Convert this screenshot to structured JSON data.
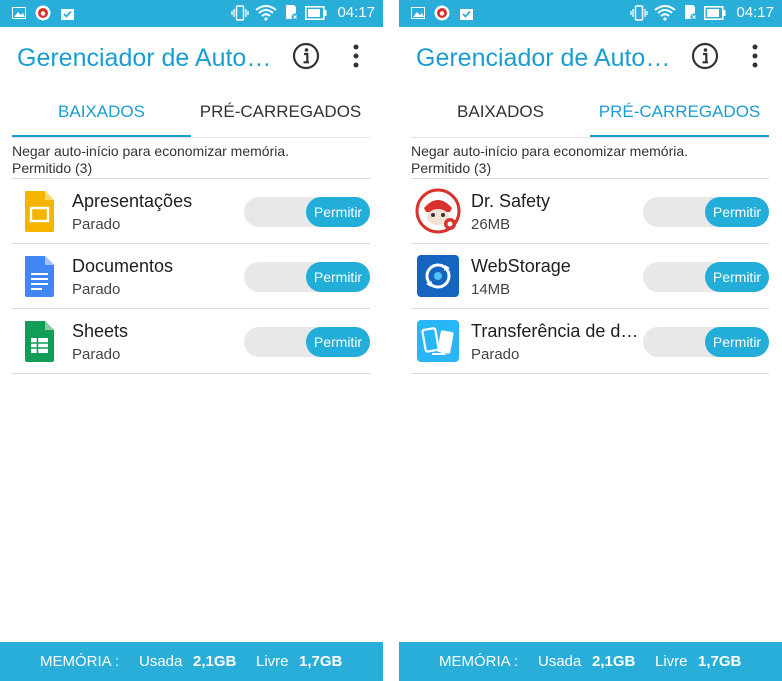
{
  "status_bar": {
    "time": "04:17"
  },
  "app": {
    "title": "Gerenciador de Auto…",
    "info_icon": "info-icon",
    "menu_icon": "more-vert-icon"
  },
  "tabs": [
    "BAIXADOS",
    "PRÉ-CARREGADOS"
  ],
  "note": "Negar auto-início para economizar memória.",
  "group_label": "Permitido (3)",
  "toggle_label": "Permitir",
  "footer": {
    "memory_label": "MEMÓRIA :",
    "used_label": "Usada",
    "used_value": "2,1GB",
    "free_label": "Livre",
    "free_value": "1,7GB"
  },
  "screens": [
    {
      "active_tab": "BAIXADOS",
      "apps": [
        {
          "name": "Apresentações",
          "status": "Parado",
          "icon": "google-slides-icon",
          "allowed": true
        },
        {
          "name": "Documentos",
          "status": "Parado",
          "icon": "google-docs-icon",
          "allowed": true
        },
        {
          "name": "Sheets",
          "status": "Parado",
          "icon": "google-sheets-icon",
          "allowed": true
        }
      ]
    },
    {
      "active_tab": "PRÉ-CARREGADOS",
      "apps": [
        {
          "name": "Dr. Safety",
          "status": "26MB",
          "icon": "dr-safety-icon",
          "allowed": true
        },
        {
          "name": "WebStorage",
          "status": "14MB",
          "icon": "webstorage-icon",
          "allowed": true
        },
        {
          "name": "Transferência de d…",
          "status": "Parado",
          "icon": "transfer-icon",
          "allowed": true
        }
      ]
    }
  ],
  "colors": {
    "accent": "#1a9ed1",
    "bar": "#28aed8",
    "toggle_on": "#22aed8",
    "toggle_track": "#e8e8e8"
  }
}
